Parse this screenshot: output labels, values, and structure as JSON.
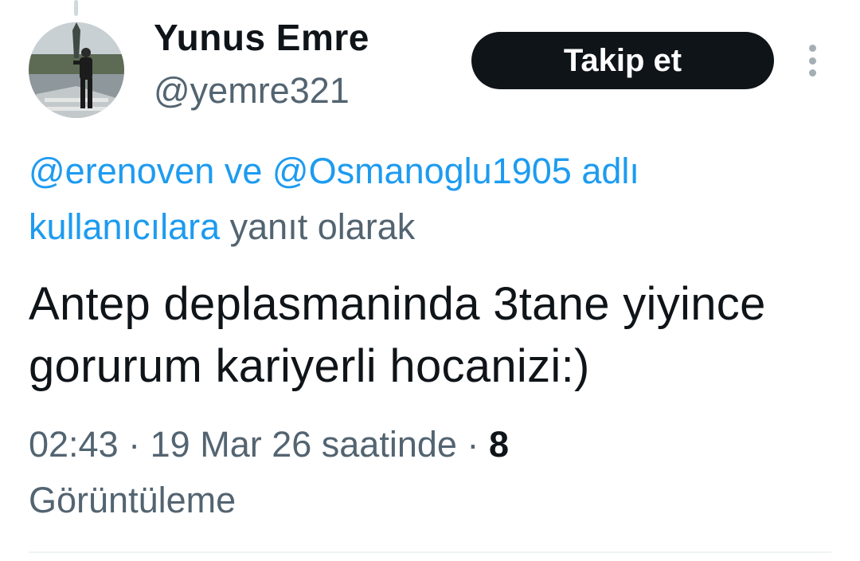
{
  "author": {
    "name": "Yunus Emre",
    "handle": "@yemre321"
  },
  "follow_label": "Takip et",
  "reply": {
    "mention1": "@erenoven",
    "connector": "ve",
    "mention2": "@Osmanoglu1905",
    "suffix_link": "adlı kullanıcılara",
    "suffix": "yanıt olarak"
  },
  "tweet": {
    "text": "Antep deplasmaninda 3tane yiyince gorurum kariyerli hocanizi:)"
  },
  "meta": {
    "time": "02:43",
    "sep1": "·",
    "date": "19 Mar 26 saatinde",
    "sep2": "·",
    "views_count": "8",
    "views_label": "Görüntüleme"
  },
  "colors": {
    "link": "#1d9bf0",
    "secondary_text": "#536471",
    "primary_text": "#0f1419",
    "button_bg": "#0f1419"
  },
  "icons": {
    "more": "more-vertical-icon"
  }
}
